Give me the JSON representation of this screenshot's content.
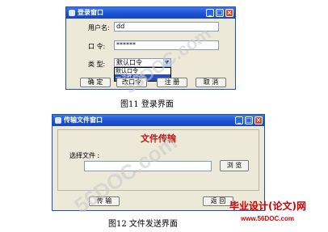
{
  "login": {
    "title": "登录窗口",
    "username_label": "用户名:",
    "username_value": "dd",
    "password_label": "口  令:",
    "password_value": "******",
    "type_label": "类  型:",
    "type_selected": "默认口令",
    "dropdown_options": [
      "默认口令",
      "一次性口令"
    ],
    "buttons": {
      "confirm": "确  定",
      "change_password": "改口令",
      "register": "注  册",
      "cancel": "取  消"
    },
    "caption": "图11  登录界面"
  },
  "transfer": {
    "title": "传输文件窗口",
    "heading": "文件传输",
    "select_label": "选择文件 :",
    "file_value": "",
    "browse": "浏  览",
    "transfer": "传  输",
    "back": "返  回",
    "caption": "图12  文件发送界面"
  },
  "watermark": {
    "text": "56DOC.com",
    "brand_title": "毕业设计(论文)网",
    "brand_url": "www.56DOC.com"
  },
  "colors": {
    "heading_red": "#c0171a",
    "brand_red": "#cc0000",
    "titlebar_blue": "#1c52d6",
    "selection_blue": "#2b4fb5"
  }
}
